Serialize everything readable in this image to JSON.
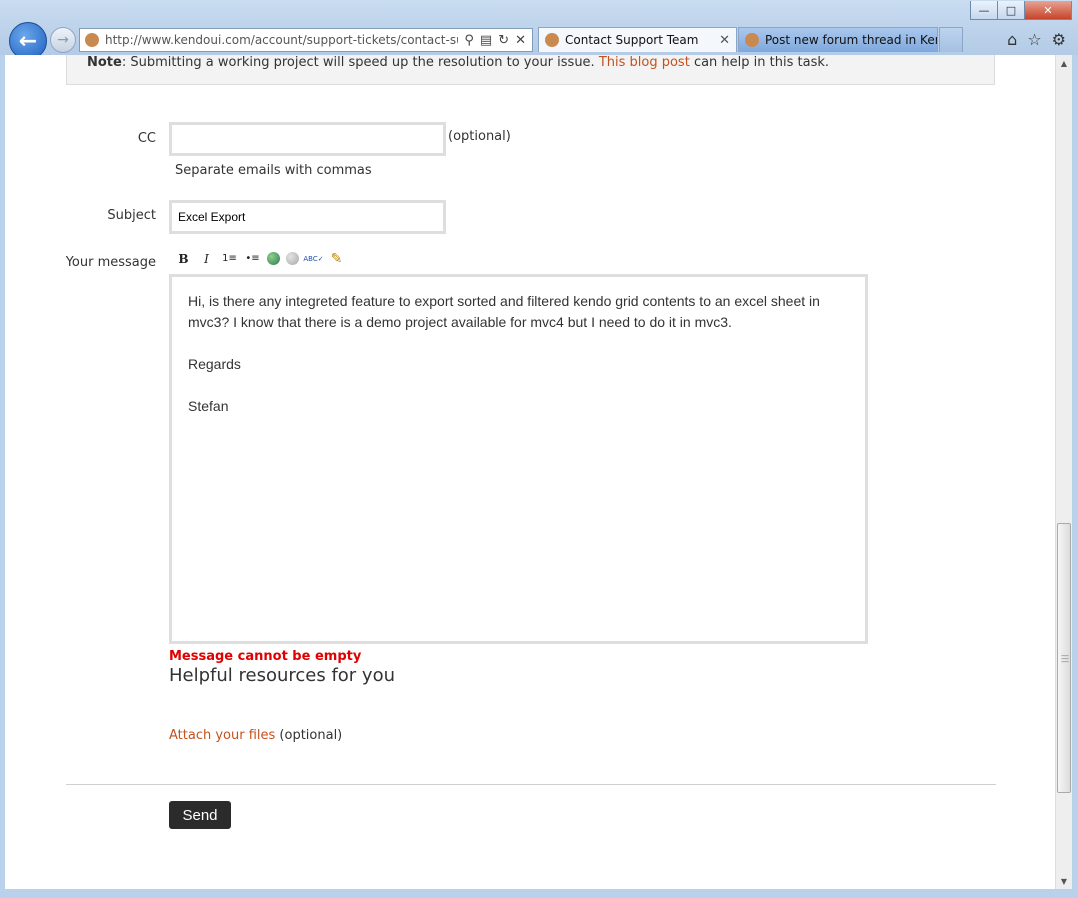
{
  "browser": {
    "url": "http://www.kendoui.com/account/support-tickets/contact-supp",
    "tabs": [
      {
        "label": "Contact Support Team",
        "active": true
      },
      {
        "label": "Post new forum thread in Ken...",
        "active": false
      }
    ],
    "icons": [
      "back-arrow-icon",
      "forward-arrow-icon",
      "search-icon",
      "compatibility-icon",
      "refresh-icon",
      "stop-icon",
      "home-icon",
      "favorites-star-icon",
      "settings-gear-icon"
    ]
  },
  "note": {
    "bold": "Note",
    "text": ": Submitting a working project will speed up the resolution to your issue. ",
    "link": "This blog post",
    "after": " can help in this task."
  },
  "form": {
    "cc": {
      "label": "CC",
      "value": "",
      "optional": "(optional)",
      "hint": "Separate emails with commas"
    },
    "subject": {
      "label": "Subject",
      "value": "Excel Export"
    },
    "message": {
      "label": "Your message",
      "paragraphs": [
        "Hi, is there any integreted feature to export sorted and filtered kendo grid contents to an excel sheet in mvc3? I know that there is a demo project available for mvc4 but I need to do it in mvc3.",
        "Regards",
        "Stefan"
      ],
      "error": "Message cannot be empty"
    },
    "resources_heading": "Helpful resources for you",
    "attach": {
      "link": "Attach your files",
      "optional": "(optional)"
    },
    "send_label": "Send"
  },
  "toolbar": {
    "bold": "B",
    "italic": "I",
    "ordered_list": "1≡",
    "unordered_list": "•≡",
    "spellcheck": "ABC✓"
  },
  "colors": {
    "link": "#c4511c",
    "error": "#e00000",
    "button": "#2b2b2b"
  }
}
